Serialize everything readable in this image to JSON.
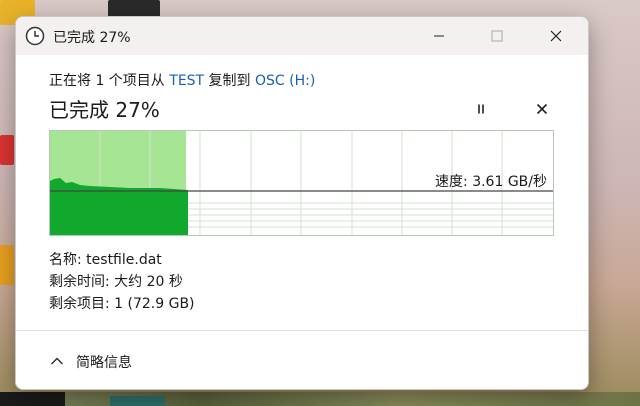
{
  "window": {
    "title": "已完成 27%"
  },
  "transfer": {
    "prefix": "正在将 1 个项目从 ",
    "source": "TEST",
    "middle": " 复制到 ",
    "destination": "OSC (H:)",
    "progress_title": "已完成 27%",
    "progress_fraction": 0.27,
    "speed_label": "速度: 3.61 GB/秒"
  },
  "details": {
    "name": "名称:  testfile.dat",
    "time_remaining": "剩余时间: 大约 20 秒",
    "items_remaining": "剩余项目: 1 (72.9 GB)"
  },
  "footer": {
    "toggle_label": "简略信息"
  },
  "colors": {
    "progress_light": "#a6e594",
    "progress_dark": "#12a82e",
    "link": "#1a5fb4"
  },
  "icons": [
    "clock-icon",
    "minimize-icon",
    "maximize-icon",
    "close-icon",
    "pause-icon",
    "cancel-icon",
    "chevron-up-icon"
  ]
}
